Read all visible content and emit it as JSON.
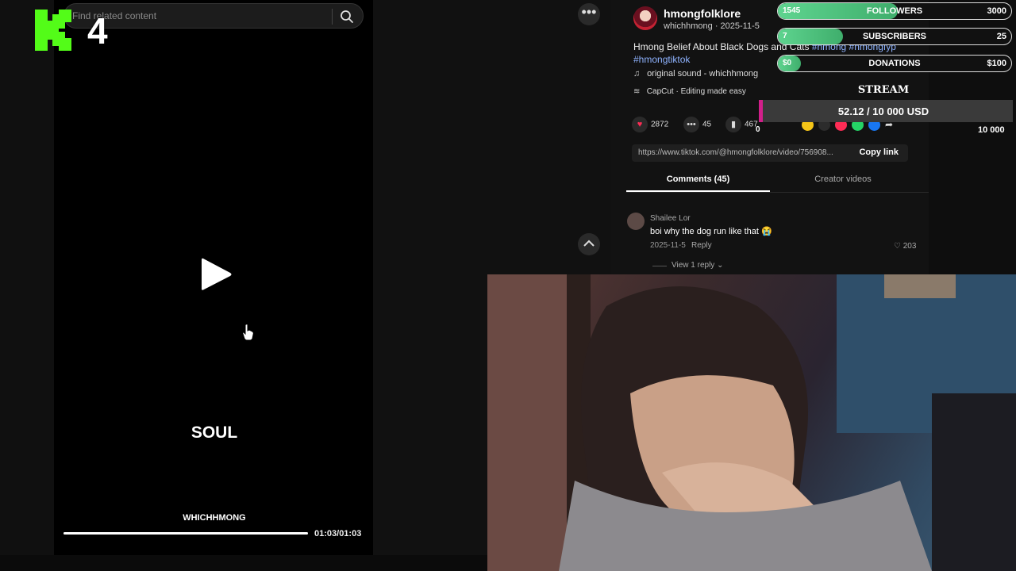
{
  "search": {
    "placeholder": "Find related content"
  },
  "overlay_logo": {
    "digit": "4",
    "color": "#53fc18"
  },
  "video": {
    "caption_main": "SOUL",
    "caption_author": "WHICHHMONG",
    "time": "01:03/01:03",
    "progress": 1.0
  },
  "post": {
    "username": "hmongfolklore",
    "subline": "whichhmong · 2025-11-5",
    "description": "Hmong Belief About Black Dogs and Cats",
    "hashtags": [
      "#hmong",
      "#hmongfyp",
      "#hmongtiktok"
    ],
    "sound": "original sound - whichhmong",
    "capcut": "CapCut · Editing made easy",
    "likes": "2872",
    "comments": "45",
    "saves": "467",
    "link": "https://www.tiktok.com/@hmongfolklore/video/756908...",
    "copy_link": "Copy link"
  },
  "tabs": {
    "comments": "Comments (45)",
    "creator": "Creator videos"
  },
  "comment": {
    "name": "Shailee Lor",
    "text": "boi why the dog run like that 😭",
    "date": "2025-11-5",
    "reply": "Reply",
    "likes": "203",
    "view_replies": "View 1 reply"
  },
  "goals": [
    {
      "label": "FOLLOWERS",
      "current": "1545",
      "target": "3000",
      "fraction": 0.515
    },
    {
      "label": "SUBSCRIBERS",
      "current": "7",
      "target": "25",
      "fraction": 0.28
    },
    {
      "label": "DONATIONS",
      "current": "$0",
      "target": "$100",
      "fraction": 0.0
    }
  ],
  "stream": {
    "title": "STREAM",
    "donation_text": "52.12 / 10 000 USD",
    "donation_min": "0",
    "donation_max": "10 000",
    "accent": "#d21f8a"
  },
  "share_colors": [
    "#f5c518",
    "#2c2c2c",
    "#fe2c55",
    "#25d366",
    "#1877f2"
  ]
}
